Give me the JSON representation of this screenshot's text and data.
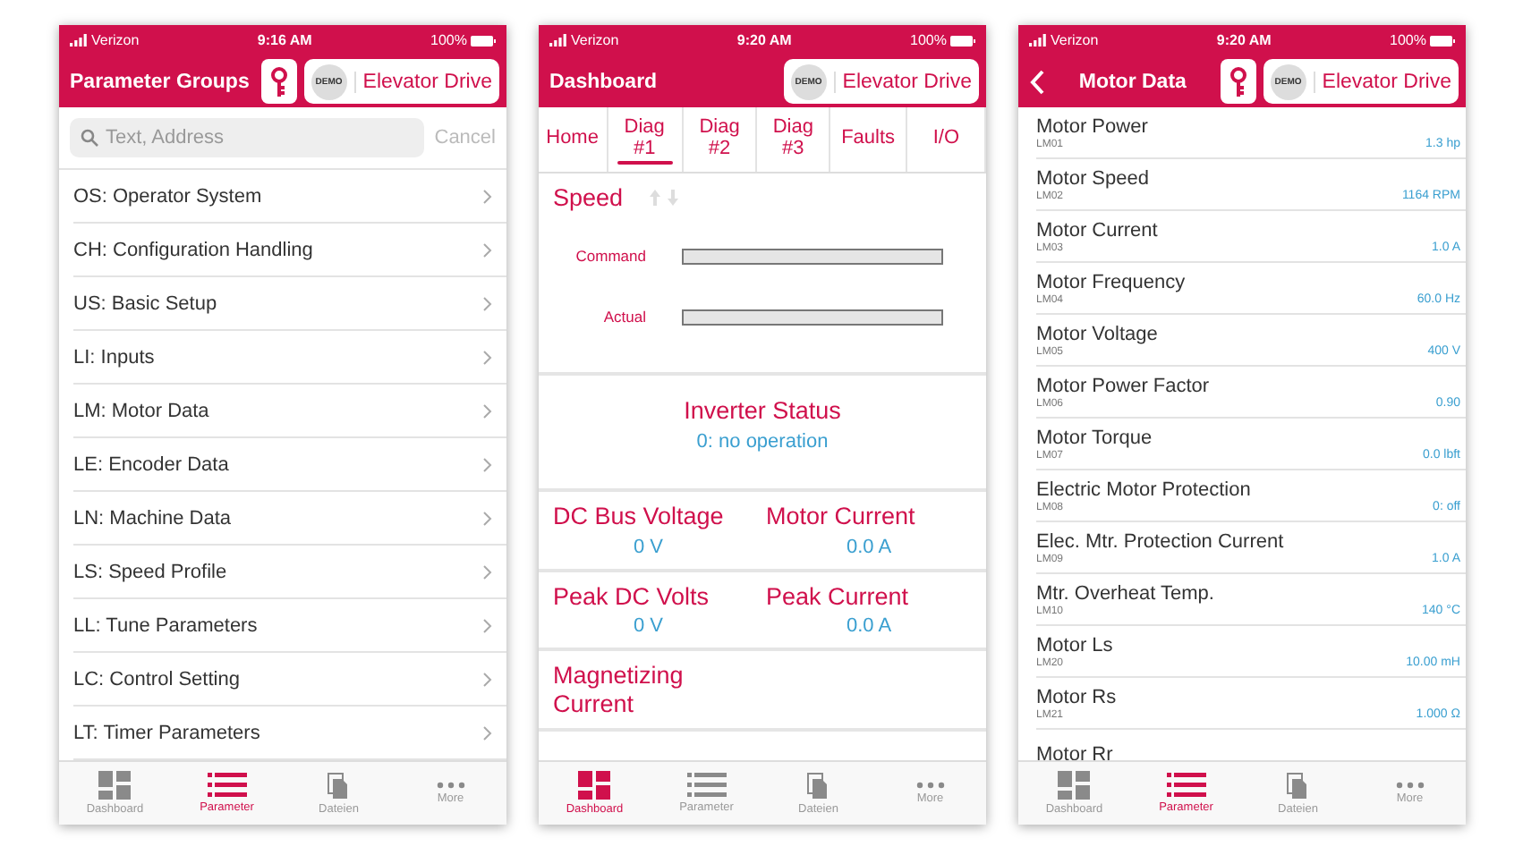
{
  "screens": [
    {
      "kind": "groups",
      "status": {
        "carrier": "Verizon",
        "time": "9:16 AM",
        "battery": "100%"
      },
      "header": {
        "title": "Parameter Groups",
        "back": false,
        "key": true,
        "badge": "DEMO",
        "device": "Elevator Drive"
      },
      "search": {
        "placeholder": "Text, Address",
        "cancel": "Cancel"
      },
      "groups": [
        "OS: Operator System",
        "CH: Configuration Handling",
        "US: Basic Setup",
        "LI: Inputs",
        "LM: Motor Data",
        "LE: Encoder Data",
        "LN: Machine Data",
        "LS: Speed Profile",
        "LL: Tune Parameters",
        "LC: Control Setting",
        "LT: Timer Parameters"
      ],
      "tabbar": [
        {
          "label": "Dashboard",
          "selected": false
        },
        {
          "label": "Parameter",
          "selected": true
        },
        {
          "label": "Dateien",
          "selected": false
        },
        {
          "label": "More",
          "selected": false
        }
      ]
    },
    {
      "kind": "dashboard",
      "status": {
        "carrier": "Verizon",
        "time": "9:20 AM",
        "battery": "100%"
      },
      "header": {
        "title": "Dashboard",
        "back": false,
        "key": false,
        "badge": "DEMO",
        "device": "Elevator Drive"
      },
      "tabs": [
        {
          "label": "Home",
          "selected": false
        },
        {
          "label": "Diag #1",
          "selected": true
        },
        {
          "label": "Diag #2",
          "selected": false
        },
        {
          "label": "Diag #3",
          "selected": false
        },
        {
          "label": "Faults",
          "selected": false
        },
        {
          "label": "I/O",
          "selected": false
        }
      ],
      "speed": {
        "title": "Speed",
        "bars": [
          {
            "label": "Command"
          },
          {
            "label": "Actual"
          }
        ]
      },
      "status_card": {
        "title": "Inverter Status",
        "value": "0: no operation"
      },
      "readings": [
        [
          {
            "label": "DC Bus Voltage",
            "value": "0 V"
          },
          {
            "label": "Motor Current",
            "value": "0.0 A"
          }
        ],
        [
          {
            "label": "Peak DC Volts",
            "value": "0 V"
          },
          {
            "label": "Peak Current",
            "value": "0.0 A"
          }
        ],
        [
          {
            "label": "Magnetizing Current"
          }
        ]
      ],
      "tabbar": [
        {
          "label": "Dashboard",
          "selected": true
        },
        {
          "label": "Parameter",
          "selected": false
        },
        {
          "label": "Dateien",
          "selected": false
        },
        {
          "label": "More",
          "selected": false
        }
      ]
    },
    {
      "kind": "params",
      "status": {
        "carrier": "Verizon",
        "time": "9:20 AM",
        "battery": "100%"
      },
      "header": {
        "title": "Motor Data",
        "back": true,
        "key": true,
        "badge": "DEMO",
        "device": "Elevator Drive"
      },
      "params": [
        {
          "name": "Motor Power",
          "code": "LM01",
          "value": "1.3 hp"
        },
        {
          "name": "Motor Speed",
          "code": "LM02",
          "value": "1164 RPM"
        },
        {
          "name": "Motor Current",
          "code": "LM03",
          "value": "1.0 A"
        },
        {
          "name": "Motor Frequency",
          "code": "LM04",
          "value": "60.0 Hz"
        },
        {
          "name": "Motor Voltage",
          "code": "LM05",
          "value": "400 V"
        },
        {
          "name": "Motor Power Factor",
          "code": "LM06",
          "value": "0.90"
        },
        {
          "name": "Motor Torque",
          "code": "LM07",
          "value": "0.0 lbft"
        },
        {
          "name": "Electric Motor Protection",
          "code": "LM08",
          "value": "0: off"
        },
        {
          "name": "Elec. Mtr. Protection Current",
          "code": "LM09",
          "value": "1.0 A"
        },
        {
          "name": "Mtr. Overheat Temp.",
          "code": "LM10",
          "value": "140 °C"
        },
        {
          "name": "Motor Ls",
          "code": "LM20",
          "value": "10.00 mH"
        },
        {
          "name": "Motor Rs",
          "code": "LM21",
          "value": "1.000 Ω"
        },
        {
          "name": "Motor Rr"
        }
      ],
      "tabbar": [
        {
          "label": "Dashboard",
          "selected": false
        },
        {
          "label": "Parameter",
          "selected": true
        },
        {
          "label": "Dateien",
          "selected": false
        },
        {
          "label": "More",
          "selected": false
        }
      ]
    }
  ]
}
